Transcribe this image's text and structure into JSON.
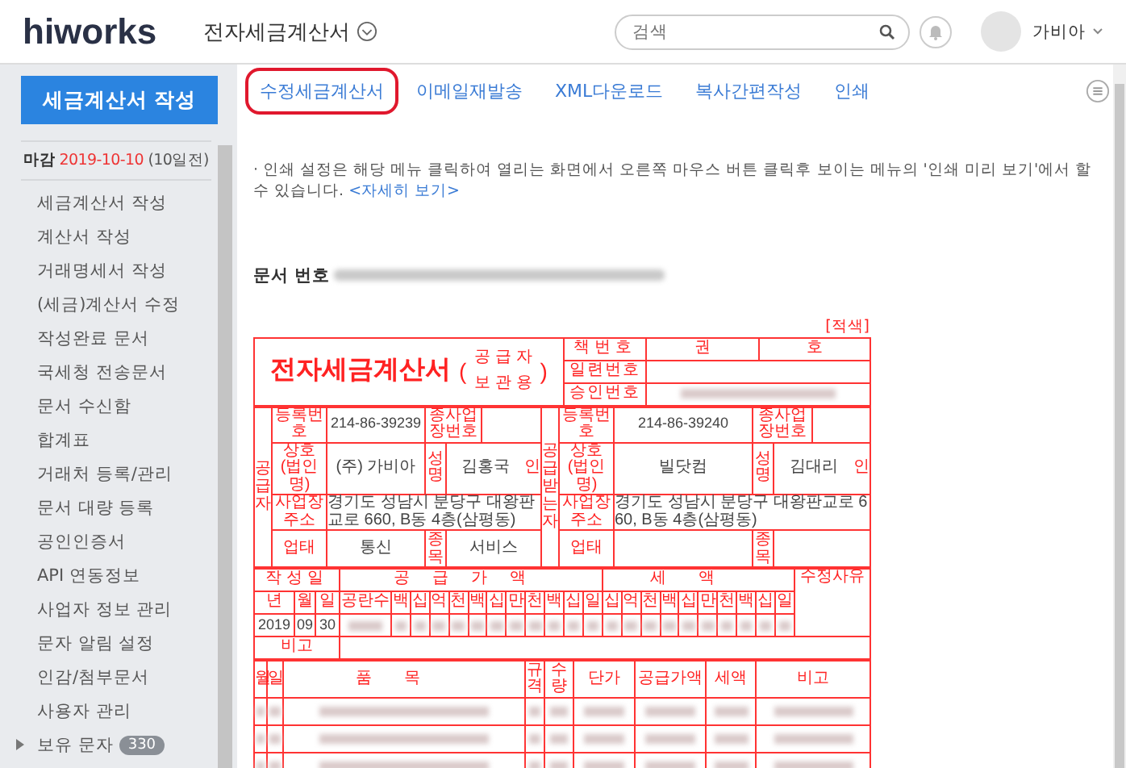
{
  "header": {
    "logo": "hiworks",
    "app_title": "전자세금계산서",
    "search": {
      "placeholder": "검색"
    },
    "user": "가비아"
  },
  "sidebar": {
    "create_button": "세금계산서 작성",
    "deadline": {
      "label": "마감",
      "date": "2019-10-10",
      "remaining": "(10일전)"
    },
    "items": [
      {
        "label": "세금계산서 작성"
      },
      {
        "label": "계산서 작성"
      },
      {
        "label": "거래명세서 작성"
      },
      {
        "label": "(세금)계산서 수정"
      },
      {
        "label": "작성완료 문서"
      },
      {
        "label": "국세청 전송문서"
      },
      {
        "label": "문서 수신함"
      },
      {
        "label": "합계표"
      },
      {
        "label": "거래처 등록/관리"
      },
      {
        "label": "문서 대량 등록"
      },
      {
        "label": "공인인증서"
      },
      {
        "label": "API 연동정보"
      },
      {
        "label": "사업자 정보 관리"
      },
      {
        "label": "문자 알림 설정"
      },
      {
        "label": "인감/첨부문서"
      },
      {
        "label": "사용자 관리"
      },
      {
        "label": "보유 문자",
        "badge": "330"
      }
    ]
  },
  "toolbar": {
    "tabs": [
      {
        "label": "수정세금계산서",
        "circled": true
      },
      {
        "label": "이메일재발송",
        "circled": false
      },
      {
        "label": "XML다운로드",
        "circled": false
      },
      {
        "label": "복사간편작성",
        "circled": false
      },
      {
        "label": "인쇄",
        "circled": false
      }
    ]
  },
  "notice": {
    "text": "· 인쇄 설정은 해당 메뉴 클릭하여 열리는 화면에서 오른쪽 마우스 버튼 클릭후 보이는 메뉴의 '인쇄 미리 보기'에서 할 수 있습니다.",
    "link": "<자세히 보기>"
  },
  "document_number": {
    "label": "문서 번호"
  },
  "invoice": {
    "color_label": "[적색]",
    "title": "전자세금계산서",
    "copy_open": "(",
    "copy_line1": "공 급 자",
    "copy_line2": "보 관 용",
    "copy_close": ")",
    "book_label": "책번호",
    "volume": "권",
    "number": "호",
    "serial_label": "일련번호",
    "approval_label": "승인번호",
    "parties": [
      {
        "side_label": "공급자",
        "reg_label": "등록번호",
        "reg_no": "214-86-39239",
        "branch_label": "종사업장번호",
        "name_label": "상호(법인명)",
        "name": "(주) 가비아",
        "rep_label": "성명",
        "rep": "김홍국",
        "seal": "인",
        "addr_label": "사업장주소",
        "address": "경기도 성남시 분당구 대왕판교로 660, B동 4층(삼평동)",
        "type_label": "업태",
        "type": "통신",
        "item_label": "종목",
        "item": "서비스"
      },
      {
        "side_label": "공급받는자",
        "reg_label": "등록번호",
        "reg_no": "214-86-39240",
        "branch_label": "종사업장번호",
        "name_label": "상호(법인명)",
        "name": "빌닷컴",
        "rep_label": "성명",
        "rep": "김대리",
        "seal": "인",
        "addr_label": "사업장주소",
        "address": "경기도 성남시 분당구 대왕판교로 660, B동 4층(삼평동)",
        "type_label": "업태",
        "item_label": "종목"
      }
    ],
    "amounts": {
      "date_header": "작성일",
      "supply_header": "공급가액",
      "tax_header": "세액",
      "reason_header": "수정사유",
      "date_cols": [
        "년",
        "월",
        "일"
      ],
      "blank_label": "공란수",
      "supply_digits": [
        "백",
        "십",
        "억",
        "천",
        "백",
        "십",
        "만",
        "천",
        "백",
        "십",
        "일"
      ],
      "tax_digits": [
        "십",
        "억",
        "천",
        "백",
        "십",
        "만",
        "천",
        "백",
        "십",
        "일"
      ],
      "date_values": [
        "2019",
        "09",
        "30"
      ],
      "memo_label": "비고"
    },
    "items": {
      "columns": [
        "월",
        "일",
        "품목",
        "규격",
        "수량",
        "단가",
        "공급가액",
        "세액",
        "비고"
      ]
    }
  }
}
